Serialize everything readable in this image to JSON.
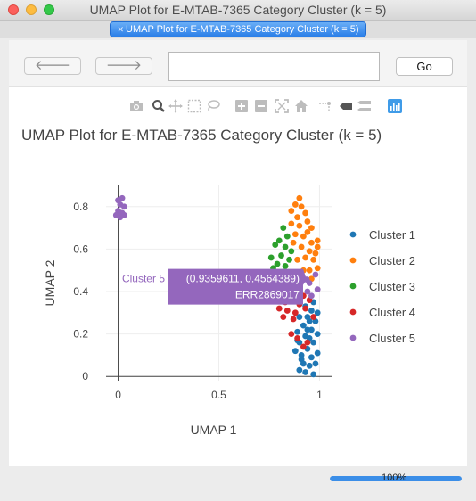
{
  "window": {
    "title": "UMAP Plot for E-MTAB-7365 Category Cluster (k = 5)"
  },
  "tab": {
    "label": "UMAP Plot for E-MTAB-7365 Category Cluster (k = 5)",
    "close_icon": "close-icon"
  },
  "toolbar": {
    "back_icon": "arrow-left-icon",
    "forward_icon": "arrow-right-icon",
    "url_value": "",
    "go_label": "Go"
  },
  "modebar": {
    "icons": [
      "camera-icon",
      "zoom-icon",
      "pan-icon",
      "box-select-icon",
      "lasso-icon",
      "zoom-in-icon",
      "zoom-out-icon",
      "autoscale-icon",
      "home-icon",
      "spike-lines-icon",
      "hover-closest-icon",
      "hover-compare-icon",
      "plotly-logo-icon"
    ]
  },
  "status": {
    "progress_label": "100%",
    "progress_fraction": 1.0
  },
  "chart_data": {
    "type": "scatter",
    "title": "UMAP Plot for E-MTAB-7365 Category Cluster (k = 5)",
    "xlabel": "UMAP 1",
    "ylabel": "UMAP 2",
    "xlim": [
      -0.06,
      1.06
    ],
    "ylim": [
      -0.02,
      0.9
    ],
    "xticks": [
      0,
      0.5,
      1
    ],
    "xtick_labels": [
      "0",
      "0.5",
      "1"
    ],
    "yticks": [
      0,
      0.2,
      0.4,
      0.6,
      0.8
    ],
    "ytick_labels": [
      "0",
      "0.2",
      "0.4",
      "0.6",
      "0.8"
    ],
    "grid": true,
    "legend_position": "right",
    "series": [
      {
        "name": "Cluster 1",
        "color": "#1f77b4",
        "points": [
          [
            0.9,
            0.03
          ],
          [
            0.93,
            0.02
          ],
          [
            0.97,
            0.01
          ],
          [
            0.95,
            0.05
          ],
          [
            0.91,
            0.08
          ],
          [
            0.96,
            0.09
          ],
          [
            0.88,
            0.12
          ],
          [
            0.94,
            0.13
          ],
          [
            0.99,
            0.11
          ],
          [
            0.9,
            0.16
          ],
          [
            0.97,
            0.16
          ],
          [
            0.93,
            0.19
          ],
          [
            0.89,
            0.21
          ],
          [
            0.96,
            0.22
          ],
          [
            0.99,
            0.2
          ],
          [
            0.92,
            0.24
          ],
          [
            0.98,
            0.26
          ],
          [
            0.94,
            0.28
          ],
          [
            0.9,
            0.28
          ],
          [
            0.96,
            0.31
          ],
          [
            0.99,
            0.3
          ],
          [
            0.93,
            0.33
          ],
          [
            0.97,
            0.35
          ],
          [
            0.91,
            0.1
          ],
          [
            0.95,
            0.18
          ],
          [
            0.98,
            0.06
          ],
          [
            0.92,
            0.06
          ],
          [
            0.95,
            0.26
          ],
          [
            0.89,
            0.17
          ],
          [
            0.94,
            0.22
          ]
        ]
      },
      {
        "name": "Cluster 2",
        "color": "#ff7f0e",
        "points": [
          [
            0.86,
            0.78
          ],
          [
            0.88,
            0.81
          ],
          [
            0.91,
            0.8
          ],
          [
            0.93,
            0.77
          ],
          [
            0.89,
            0.75
          ],
          [
            0.86,
            0.72
          ],
          [
            0.9,
            0.71
          ],
          [
            0.94,
            0.73
          ],
          [
            0.96,
            0.7
          ],
          [
            0.88,
            0.67
          ],
          [
            0.92,
            0.66
          ],
          [
            0.96,
            0.63
          ],
          [
            0.99,
            0.61
          ],
          [
            0.87,
            0.63
          ],
          [
            0.91,
            0.61
          ],
          [
            0.95,
            0.59
          ],
          [
            0.99,
            0.64
          ],
          [
            0.93,
            0.56
          ],
          [
            0.97,
            0.55
          ],
          [
            0.89,
            0.55
          ],
          [
            0.95,
            0.5
          ],
          [
            0.99,
            0.51
          ],
          [
            0.92,
            0.5
          ],
          [
            0.96,
            0.46
          ],
          [
            0.98,
            0.58
          ],
          [
            0.9,
            0.84
          ],
          [
            0.94,
            0.68
          ]
        ]
      },
      {
        "name": "Cluster 3",
        "color": "#2ca02c",
        "points": [
          [
            0.82,
            0.7
          ],
          [
            0.84,
            0.66
          ],
          [
            0.8,
            0.64
          ],
          [
            0.78,
            0.62
          ],
          [
            0.83,
            0.61
          ],
          [
            0.86,
            0.59
          ],
          [
            0.81,
            0.57
          ],
          [
            0.76,
            0.56
          ],
          [
            0.85,
            0.55
          ],
          [
            0.79,
            0.53
          ],
          [
            0.83,
            0.52
          ],
          [
            0.77,
            0.51
          ],
          [
            0.8,
            0.49
          ]
        ]
      },
      {
        "name": "Cluster 4",
        "color": "#d62728",
        "points": [
          [
            0.85,
            0.42
          ],
          [
            0.88,
            0.4
          ],
          [
            0.92,
            0.38
          ],
          [
            0.86,
            0.37
          ],
          [
            0.83,
            0.35
          ],
          [
            0.9,
            0.34
          ],
          [
            0.95,
            0.36
          ],
          [
            0.8,
            0.32
          ],
          [
            0.84,
            0.31
          ],
          [
            0.88,
            0.3
          ],
          [
            0.93,
            0.32
          ],
          [
            0.82,
            0.28
          ],
          [
            0.87,
            0.27
          ],
          [
            0.97,
            0.28
          ],
          [
            0.86,
            0.2
          ],
          [
            0.89,
            0.18
          ],
          [
            0.92,
            0.14
          ],
          [
            0.94,
            0.16
          ]
        ]
      },
      {
        "name": "Cluster 5",
        "color": "#9467bd",
        "points": [
          [
            0.0,
            0.83
          ],
          [
            0.02,
            0.84
          ],
          [
            0.01,
            0.81
          ],
          [
            0.03,
            0.8
          ],
          [
            0.0,
            0.78
          ],
          [
            0.02,
            0.77
          ],
          [
            -0.01,
            0.76
          ],
          [
            0.03,
            0.76
          ],
          [
            0.01,
            0.75
          ],
          [
            0.9359611,
            0.4564389
          ],
          [
            0.95,
            0.44
          ],
          [
            0.94,
            0.4
          ],
          [
            0.96,
            0.38
          ],
          [
            0.98,
            0.48
          ],
          [
            0.99,
            0.41
          ]
        ]
      }
    ],
    "hover": {
      "series": "Cluster 5",
      "text_line1": "(0.9359611, 0.4564389)",
      "text_line2": "ERR2869017",
      "x": 0.9359611,
      "y": 0.4564389
    }
  }
}
